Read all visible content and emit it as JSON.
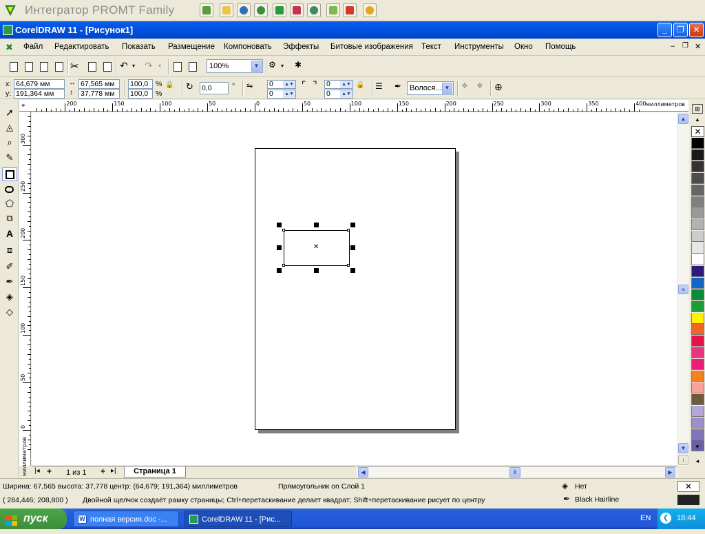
{
  "promt": {
    "title": "Интегратор PROMT Family"
  },
  "window": {
    "title": "CorelDRAW 11 - [Рисунок1]"
  },
  "menu": [
    "Файл",
    "Редактировать",
    "Показать",
    "Размещение",
    "Компоновать",
    "Эффекты",
    "Битовые изображения",
    "Текст",
    "Инструменты",
    "Окно",
    "Помощь"
  ],
  "standard_bar": {
    "zoom": "100%"
  },
  "property_bar": {
    "x_label": "x:",
    "x": "64,679 мм",
    "y_label": "y:",
    "y": "191,364 мм",
    "width": "67,565 мм",
    "height": "37,778 мм",
    "scale_w": "100,0",
    "scale_h": "100,0",
    "pct": "%",
    "rotation": "0,0",
    "degree": "°",
    "corner_tl": "0",
    "corner_bl": "0",
    "corner_tr": "0",
    "corner_br": "0",
    "outline": "Волося..."
  },
  "ruler": {
    "units": "миллиметров",
    "top_labels": [
      "200",
      "150",
      "100",
      "50",
      "0",
      "50",
      "100",
      "150",
      "200",
      "250",
      "300",
      "350",
      "400"
    ],
    "left_labels": [
      "300",
      "250",
      "200",
      "150",
      "100",
      "50",
      "0"
    ],
    "left_units": "миллиметров"
  },
  "page_tabs": {
    "count": "1 из 1",
    "tab": "Страница 1"
  },
  "status": {
    "size": "Ширина: 67,565  высота: 37,778  центр: (64,679; 191,364)  миллиметров",
    "object": "Прямоугольник on Слой 1",
    "fill": "Нет",
    "coords": "( 284,446; 208,800 )",
    "hint": "Двойной щелчок создаёт рамку страницы; Ctrl+перетаскивание делает квадрат; Shift+перетаскивание рисует по центру",
    "outline": "Black  Hairline"
  },
  "taskbar": {
    "start": "пуск",
    "task1": "полная версия.doc -...",
    "task2": "CorelDRAW 11 - [Рис...",
    "lang": "EN",
    "time": "18:44"
  },
  "colors": {
    "palette": [
      "#000000",
      "#1a1a1a",
      "#333333",
      "#4d4d4d",
      "#666666",
      "#808080",
      "#999999",
      "#b3b3b3",
      "#cccccc",
      "#e6e6e6",
      "#ffffff",
      "#2e1a78",
      "#1166c8",
      "#0a8a3a",
      "#1b9e3a",
      "#fff200",
      "#f26522",
      "#e8114a",
      "#e9357b",
      "#ed1c7a",
      "#f58220",
      "#f7a29a",
      "#6d5a3e",
      "#b4a6d6",
      "#9b8fc9",
      "#7f75b8",
      "#6b5fa6"
    ]
  }
}
